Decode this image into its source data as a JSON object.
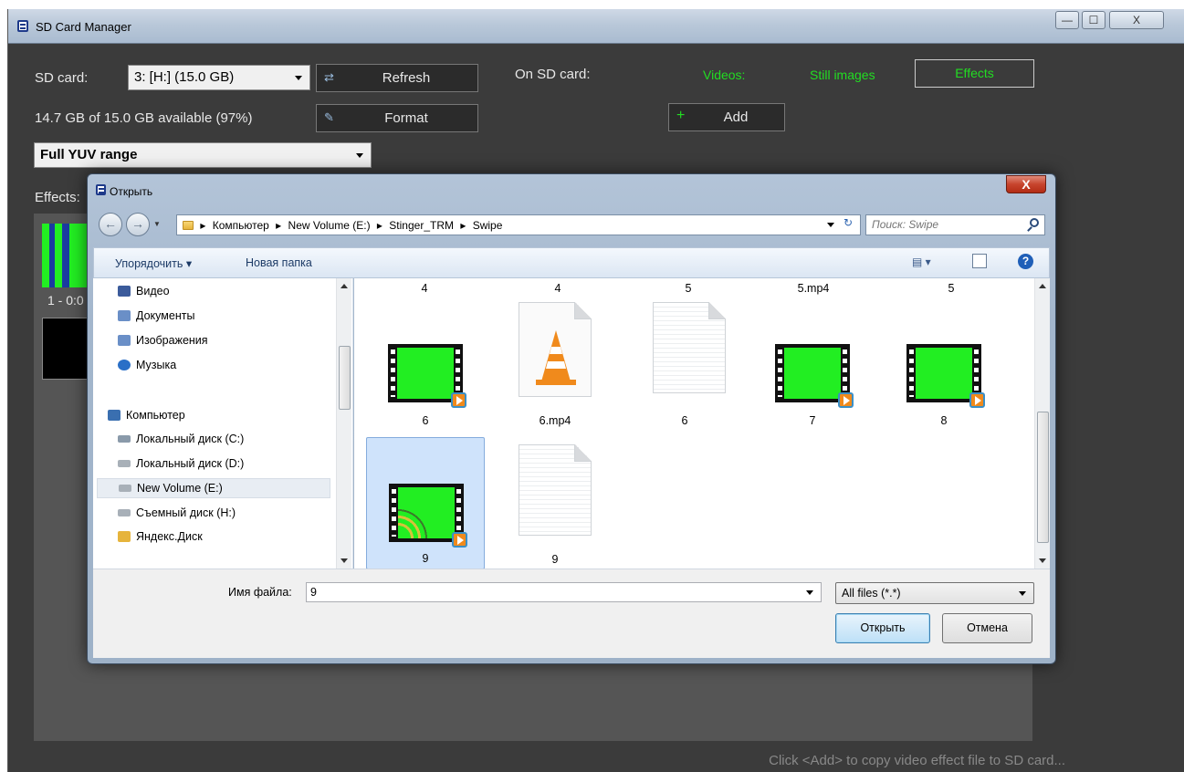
{
  "app": {
    "title": "SD Card Manager",
    "sd_card_label": "SD card:",
    "sd_card_value": "3: [H:] (15.0 GB)",
    "refresh_label": "Refresh",
    "format_label": "Format",
    "available_text": "14.7 GB of 15.0 GB available (97%)",
    "yuv_value": "Full YUV range",
    "on_sd_card_label": "On SD card:",
    "tab_videos": "Videos:",
    "tab_still_images": "Still images",
    "tab_effects": "Effects",
    "add_label": "Add",
    "effects_label": "Effects:",
    "effect_caption": "1 - 0:0",
    "status_text": "Click <Add> to copy video effect file to SD card...",
    "caption_buttons": [
      "—",
      "☐",
      "X"
    ]
  },
  "dialog": {
    "title": "Открыть",
    "close": "X",
    "breadcrumbs": [
      "Компьютер",
      "New Volume (E:)",
      "Stinger_TRM",
      "Swipe"
    ],
    "search_placeholder": "Поиск: Swipe",
    "toolbar": {
      "organize": "Упорядочить ▾",
      "new_folder": "Новая папка"
    },
    "nav_items": [
      {
        "label": "Видео",
        "icon": "video-library-icon",
        "color": "#3b5b9b"
      },
      {
        "label": "Документы",
        "icon": "documents-library-icon",
        "color": "#6a8fc7"
      },
      {
        "label": "Изображения",
        "icon": "pictures-library-icon",
        "color": "#6a8fc7"
      },
      {
        "label": "Музыка",
        "icon": "music-library-icon",
        "color": "#2a6fc7"
      },
      {
        "label": "Компьютер",
        "icon": "computer-icon",
        "color": "#3a6fb0"
      },
      {
        "label": "Локальный диск (C:)",
        "icon": "local-disk-c-icon",
        "color": "#8a9aaa"
      },
      {
        "label": "Локальный диск (D:)",
        "icon": "local-disk-d-icon",
        "color": "#a8b0b8"
      },
      {
        "label": "New Volume (E:)",
        "icon": "drive-e-icon",
        "color": "#a8b0b8"
      },
      {
        "label": "Съемный диск (H:)",
        "icon": "removable-disk-icon",
        "color": "#a8b0b8"
      },
      {
        "label": "Яндекс.Диск",
        "icon": "yandex-disk-folder-icon",
        "color": "#e6b43c"
      }
    ],
    "top_row_labels": [
      "4",
      "4",
      "5",
      "5.mp4",
      "5"
    ],
    "files": [
      {
        "name": "6",
        "kind": "video"
      },
      {
        "name": "6.mp4",
        "kind": "vlc"
      },
      {
        "name": "6",
        "kind": "doc"
      },
      {
        "name": "7",
        "kind": "video"
      },
      {
        "name": "8",
        "kind": "video"
      },
      {
        "name": "9",
        "kind": "video-swipe",
        "selected": true
      },
      {
        "name": "9",
        "kind": "doc"
      }
    ],
    "filename_label": "Имя файла:",
    "filename_value": "9",
    "filter_value": "All files (*.*)",
    "open_label": "Открыть",
    "cancel_label": "Отмена"
  },
  "colors": {
    "accent_green": "#22dd22",
    "app_bg": "#3b3b3b",
    "selection": "#cfe3fb"
  }
}
